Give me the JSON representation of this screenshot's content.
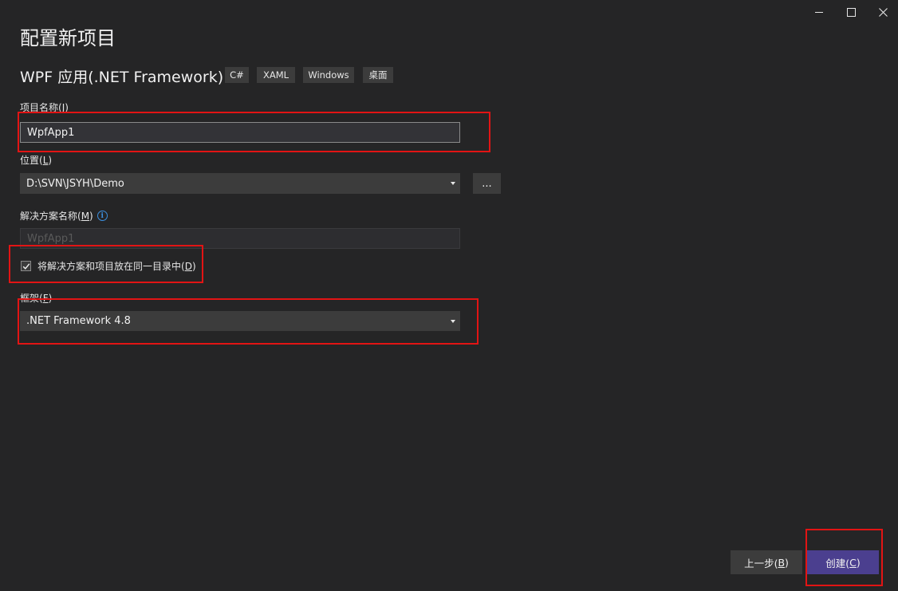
{
  "window": {
    "title": "配置新项目",
    "template": "WPF 应用(.NET Framework)",
    "tags": [
      "C#",
      "XAML",
      "Windows",
      "桌面"
    ],
    "controls": [
      "minimize",
      "maximize",
      "close"
    ]
  },
  "fields": {
    "project_name": {
      "label_prefix": "项目名称(",
      "label_key": "J",
      "label_suffix": ")",
      "value": "WpfApp1"
    },
    "location": {
      "label_prefix": "位置(",
      "label_key": "L",
      "label_suffix": ")",
      "value": "D:\\SVN\\JSYH\\Demo",
      "browse_label": "..."
    },
    "solution_name": {
      "label_prefix": "解决方案名称(",
      "label_key": "M",
      "label_suffix": ")",
      "value": "WpfApp1",
      "enabled": false
    },
    "same_dir": {
      "label_prefix": "将解决方案和项目放在同一目录中(",
      "label_key": "D",
      "label_suffix": ")",
      "checked": true
    },
    "framework": {
      "label_prefix": "框架(",
      "label_key": "F",
      "label_suffix": ")",
      "value": ".NET Framework 4.8"
    }
  },
  "footer": {
    "back": {
      "label_prefix": "上一步(",
      "label_key": "B",
      "label_suffix": ")"
    },
    "create": {
      "label_prefix": "创建(",
      "label_key": "C",
      "label_suffix": ")"
    }
  },
  "colors": {
    "accent": "#4b3f8f",
    "highlight": "#e21414",
    "background": "#252526"
  }
}
